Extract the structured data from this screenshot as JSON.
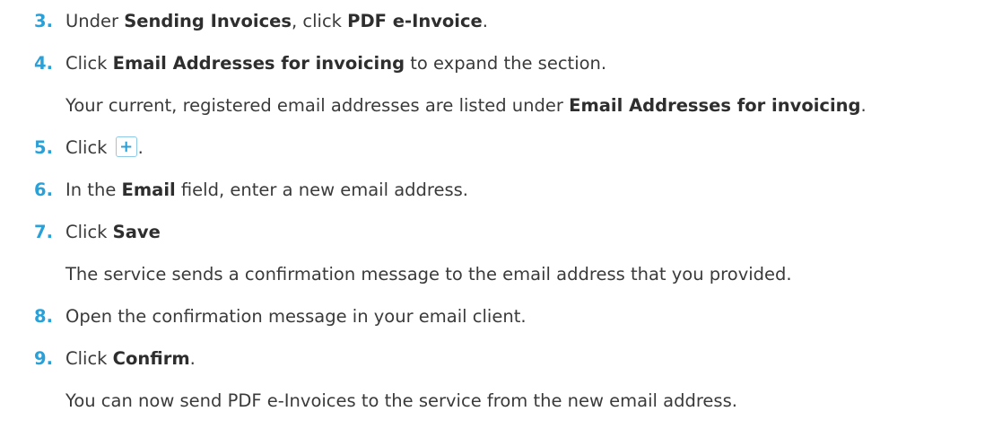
{
  "steps": [
    {
      "num": "3.",
      "t1": "Under ",
      "b1": "Sending Invoices",
      "t2": ", click ",
      "b2": "PDF e-Invoice",
      "t3": "."
    },
    {
      "num": "4.",
      "t1": "Click ",
      "b1": "Email Addresses for invoicing",
      "t2": " to expand the section."
    },
    {
      "num": "5.",
      "t1": "Click ",
      "icon": "+",
      "t2": "."
    },
    {
      "num": "6.",
      "t1": "In the ",
      "b1": "Email",
      "t2": " field, enter a new email address."
    },
    {
      "num": "7.",
      "t1": "Click ",
      "b1": "Save"
    },
    {
      "num": "8.",
      "t1": "Open the confirmation message in your email client."
    },
    {
      "num": "9.",
      "t1": "Click ",
      "b1": "Confirm",
      "t2": "."
    }
  ],
  "notes": {
    "after_4": {
      "t1": "Your current, registered email addresses are listed under ",
      "b1": "Email Addresses for invoicing",
      "t2": "."
    },
    "after_7": {
      "t1": "The service sends a confirmation message to the email address that you provided."
    },
    "after_9": {
      "t1": "You can now send PDF e-Invoices to the service from the new email address."
    }
  },
  "colors": {
    "accent": "#2aa0d8",
    "text": "#3a3a3a"
  },
  "icons": {
    "add_button": "plus-icon"
  }
}
